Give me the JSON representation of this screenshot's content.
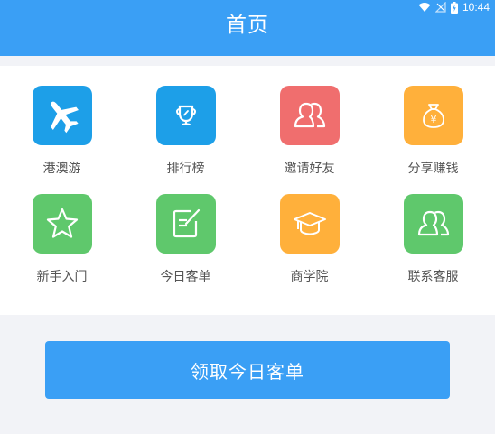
{
  "status_bar": {
    "time": "10:44",
    "icons": [
      "wifi-icon",
      "no-signal-icon",
      "battery-charging-icon"
    ]
  },
  "header": {
    "title": "首页",
    "color": "#3a9ff5"
  },
  "grid": {
    "items": [
      {
        "label": "港澳游",
        "icon": "airplane-icon",
        "color": "#1d9fe8"
      },
      {
        "label": "排行榜",
        "icon": "trophy-icon",
        "color": "#1d9fe8"
      },
      {
        "label": "邀请好友",
        "icon": "friends-icon",
        "color": "#f06e6e"
      },
      {
        "label": "分享赚钱",
        "icon": "money-bag-icon",
        "color": "#ffb03b"
      },
      {
        "label": "新手入门",
        "icon": "star-icon",
        "color": "#5fc86c"
      },
      {
        "label": "今日客单",
        "icon": "note-edit-icon",
        "color": "#5fc86c"
      },
      {
        "label": "商学院",
        "icon": "graduation-cap-icon",
        "color": "#ffb03b"
      },
      {
        "label": "联系客服",
        "icon": "service-person-icon",
        "color": "#5fc86c"
      }
    ]
  },
  "claim_button": {
    "label": "领取今日客单",
    "color": "#3a9ff5"
  }
}
